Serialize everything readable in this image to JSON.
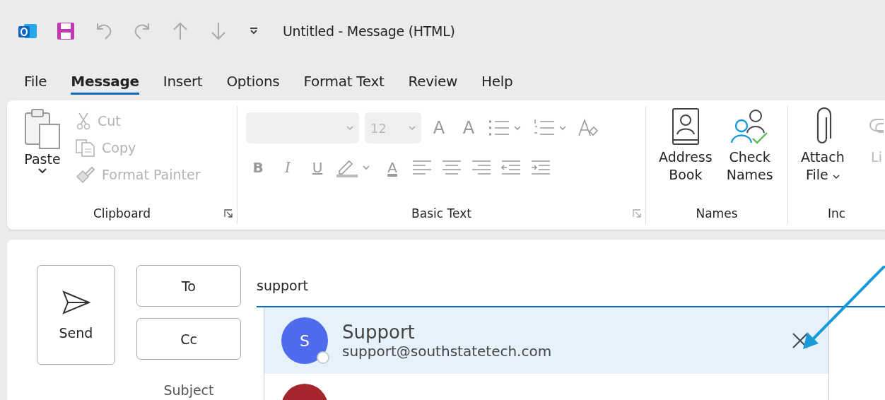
{
  "window": {
    "title": "Untitled  -  Message (HTML)"
  },
  "tabs": [
    {
      "label": "File",
      "selected": false
    },
    {
      "label": "Message",
      "selected": true
    },
    {
      "label": "Insert",
      "selected": false
    },
    {
      "label": "Options",
      "selected": false
    },
    {
      "label": "Format Text",
      "selected": false
    },
    {
      "label": "Review",
      "selected": false
    },
    {
      "label": "Help",
      "selected": false
    }
  ],
  "ribbon": {
    "clipboard": {
      "label": "Clipboard",
      "paste": "Paste",
      "items": [
        {
          "kind": "cut",
          "label": "Cut",
          "disabled": true
        },
        {
          "kind": "copy",
          "label": "Copy",
          "disabled": true
        },
        {
          "kind": "painter",
          "label": "Format Painter",
          "disabled": true
        }
      ]
    },
    "basic_text": {
      "label": "Basic Text",
      "font_size": "12",
      "row1": [
        {
          "kind": "letter",
          "label": "A"
        },
        {
          "kind": "letter",
          "label": "A"
        },
        {
          "kind": "bullets"
        },
        {
          "kind": "numbers"
        },
        {
          "kind": "clear"
        }
      ],
      "row2": [
        {
          "kind": "letter",
          "label": "B"
        },
        {
          "kind": "letter",
          "label": "I"
        },
        {
          "kind": "letter",
          "label": "U"
        },
        {
          "kind": "highlight"
        },
        {
          "kind": "letter",
          "label": "A"
        },
        {
          "kind": "align-left"
        },
        {
          "kind": "align-center"
        },
        {
          "kind": "align-right"
        },
        {
          "kind": "outdent"
        },
        {
          "kind": "indent"
        }
      ]
    },
    "names": {
      "label": "Names",
      "buttons": [
        {
          "kind": "book",
          "lines": [
            "Address",
            "Book"
          ]
        },
        {
          "kind": "check",
          "lines": [
            "Check",
            "Names"
          ]
        }
      ]
    },
    "include": {
      "label": "Inc",
      "buttons": [
        {
          "kind": "attach",
          "lines": [
            "Attach",
            "File"
          ]
        },
        {
          "kind": "link",
          "lines": [
            "Li"
          ]
        }
      ]
    }
  },
  "compose": {
    "send": "Send",
    "to": "To",
    "cc": "Cc",
    "subject": "Subject",
    "to_value": "support",
    "suggestions": [
      {
        "initial": "S",
        "name": "Support",
        "email": "support@southstatetech.com",
        "color": "#4f6bed",
        "selected": true
      },
      {
        "color": "#a4262c",
        "selected": false
      }
    ]
  }
}
